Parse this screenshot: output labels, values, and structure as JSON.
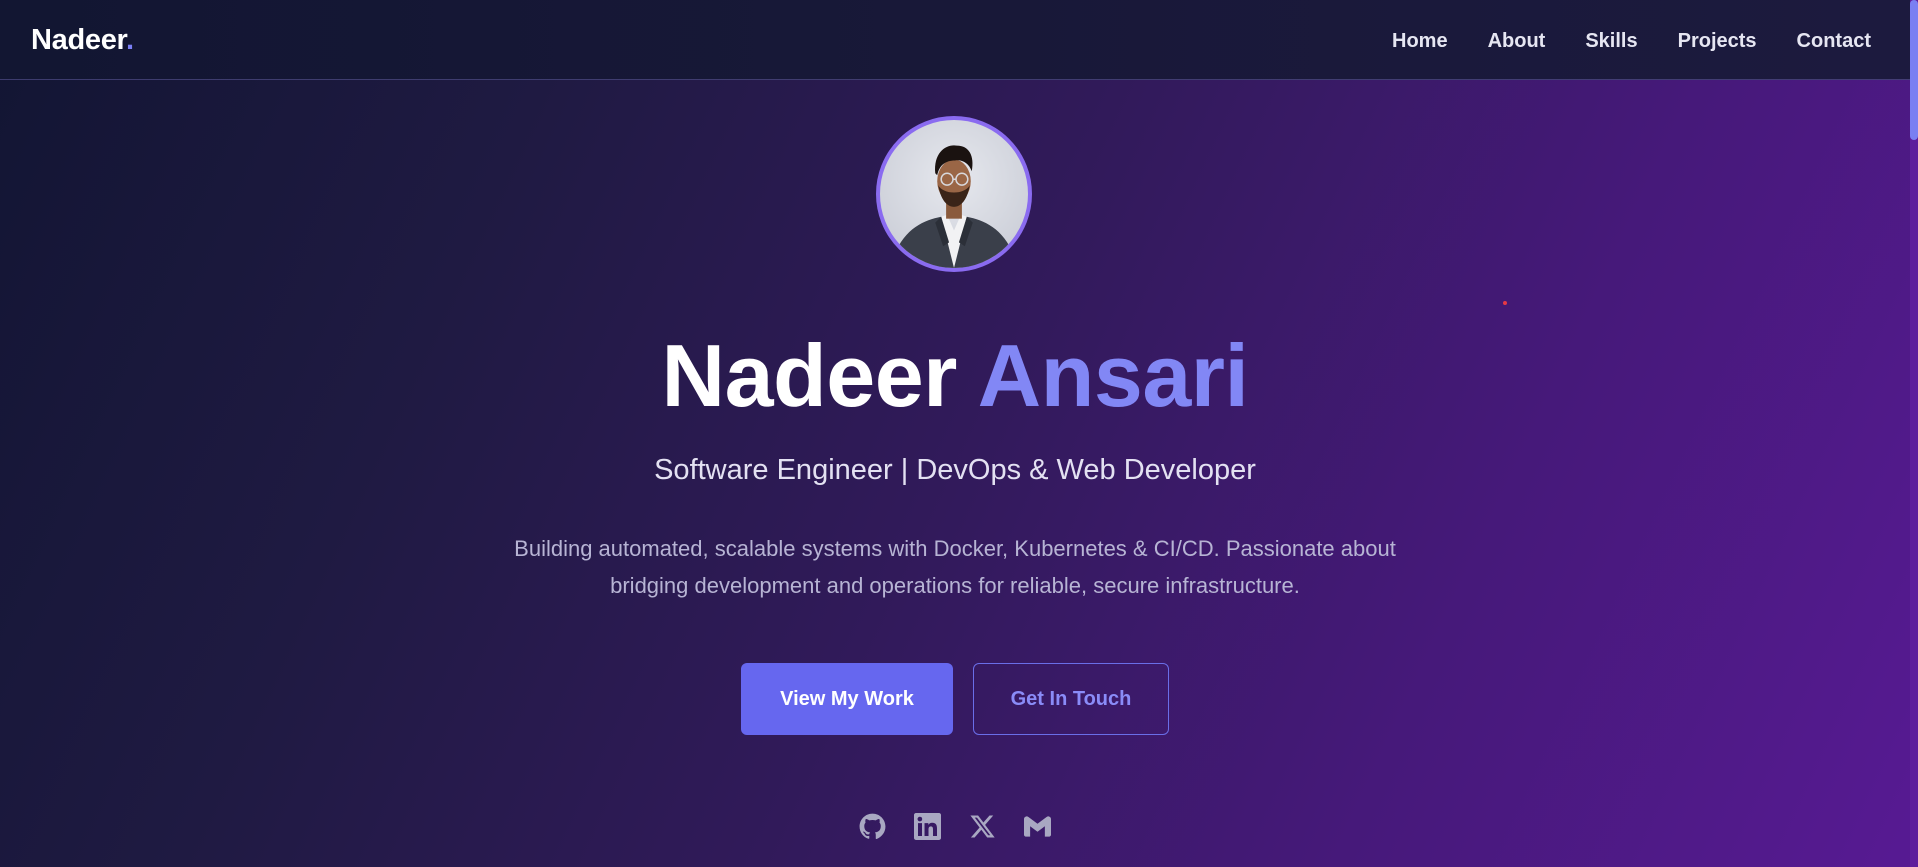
{
  "header": {
    "logo_text": "Nadeer",
    "logo_dot": ".",
    "nav": [
      {
        "label": "Home"
      },
      {
        "label": "About"
      },
      {
        "label": "Skills"
      },
      {
        "label": "Projects"
      },
      {
        "label": "Contact"
      }
    ]
  },
  "hero": {
    "first_name": "Nadeer",
    "last_name": "Ansari",
    "subtitle": "Software Engineer | DevOps & Web Developer",
    "description": "Building automated, scalable systems with Docker, Kubernetes & CI/CD. Passionate about bridging development and operations for reliable, secure infrastructure.",
    "primary_button": "View My Work",
    "secondary_button": "Get In Touch",
    "socials": [
      {
        "icon": "github-icon"
      },
      {
        "icon": "linkedin-icon"
      },
      {
        "icon": "x-icon"
      },
      {
        "icon": "gmail-icon"
      }
    ]
  },
  "colors": {
    "accent": "#6667ef",
    "accent_text": "#8287f5",
    "background_start": "#121533",
    "background_end": "#571a93"
  }
}
